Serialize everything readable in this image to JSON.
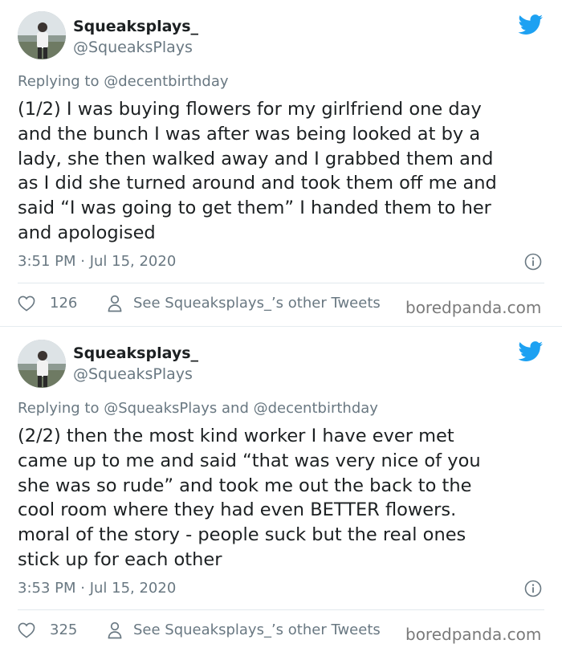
{
  "tweets": [
    {
      "author_name": "Squeaksplays_",
      "author_handle": "@SqueaksPlays",
      "replying_to": "Replying to @decentbirthday",
      "text": "(1/2) I was buying flowers for my girlfriend one day\nand the bunch I was after was being looked at by a\nlady, she then walked away and I grabbed them and\nas I did she turned around and took them off me and\nsaid “I was going to get them” I handed them to her\nand apologised",
      "timestamp": "3:51 PM · Jul 15, 2020",
      "likes": "126",
      "other_tweets_label": "See Squeaksplays_’s other Tweets",
      "watermark": "boredpanda.com"
    },
    {
      "author_name": "Squeaksplays_",
      "author_handle": "@SqueaksPlays",
      "replying_to": "Replying to @SqueaksPlays and @decentbirthday",
      "text": "(2/2) then the most kind worker I have ever met\ncame up to me and said “that was very nice of you\nshe was so rude” and took me out the back to the\ncool room where they had even BETTER flowers.\nmoral of the story - people suck but the real ones\nstick up for each other",
      "timestamp": "3:53 PM · Jul 15, 2020",
      "likes": "325",
      "other_tweets_label": "See Squeaksplays_’s other Tweets",
      "watermark": "boredpanda.com"
    }
  ],
  "icons": {
    "logo": "twitter-bird-icon",
    "info": "info-icon",
    "like": "heart-icon",
    "profile": "person-icon"
  },
  "colors": {
    "twitter_blue": "#1da1f2",
    "secondary_text": "#697882",
    "primary_text": "#1c2022"
  }
}
